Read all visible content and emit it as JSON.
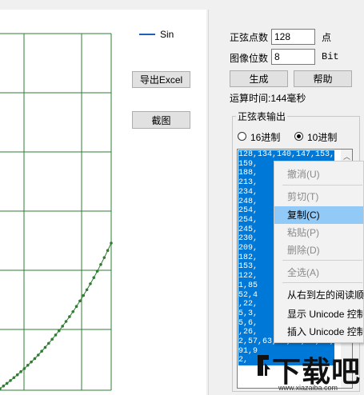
{
  "chart_data": {
    "type": "line",
    "series": [
      {
        "name": "Sin",
        "color": "#2e7d32",
        "x": [
          0,
          1,
          2,
          3,
          4,
          5,
          6,
          7,
          8,
          9,
          10,
          11,
          12,
          13,
          14,
          15,
          16,
          17,
          18,
          19,
          20,
          21,
          22,
          23,
          24,
          25,
          26,
          27,
          28,
          29,
          30,
          31,
          32
        ],
        "y": [
          0,
          1.1,
          2.2,
          3.4,
          4.6,
          5.8,
          7.1,
          8.4,
          9.8,
          11.2,
          12.6,
          14.1,
          15.7,
          17.3,
          19.0,
          20.7,
          22.5,
          24.3,
          26.2,
          28.2,
          30.2,
          32.3,
          34.5,
          36.8,
          39.1,
          41.5,
          44.0,
          46.6,
          49.3,
          52.1,
          55.0,
          58.0,
          61.1
        ]
      }
    ],
    "legend": "top-right",
    "grid": true
  },
  "legend": {
    "label": "Sin"
  },
  "buttons": {
    "export_excel": "导出Excel",
    "screenshot": "截图",
    "generate": "生成",
    "help": "帮助"
  },
  "form": {
    "points_label": "正弦点数",
    "points_value": "128",
    "points_unit": "点",
    "bits_label": "图像位数",
    "bits_value": "8",
    "bits_unit": "Bit",
    "elapsed": "运算时间:144毫秒"
  },
  "output_group": {
    "title": "正弦表输出",
    "radio_hex": "16进制",
    "radio_dec": "10进制",
    "selected": "10进制",
    "lines": [
      "128,134,140,147,153,",
      "159,",
      "188,",
      "213,",
      "234,",
      "248,",
      "254,",
      "254,",
      "245,",
      "230,",
      "209,",
      "182,",
      "153,",
      "122,",
      "1,85",
      "52,4",
      ",22,",
      "5,3,",
      "5,6,",
      ",26,",
      "2,57,63,68,74,79,85,",
      "91,9",
      "2,"
    ]
  },
  "context_menu": {
    "items": [
      {
        "label": "撤消(U)",
        "disabled": true
      },
      {
        "label": "剪切(T)",
        "disabled": true
      },
      {
        "label": "复制(C)",
        "disabled": false,
        "highlighted": true
      },
      {
        "label": "粘贴(P)",
        "disabled": true
      },
      {
        "label": "删除(D)",
        "disabled": true
      },
      {
        "label": "全选(A)",
        "disabled": true
      },
      {
        "label": "从右到左的阅读顺序(R)",
        "disabled": false
      },
      {
        "label": "显示 Unicode 控制字符(S)",
        "disabled": false
      },
      {
        "label": "插入 Unicode 控制字符(I)",
        "disabled": false
      }
    ]
  },
  "watermark": {
    "main": "下载吧",
    "url": "www.xiazaiba.com"
  }
}
